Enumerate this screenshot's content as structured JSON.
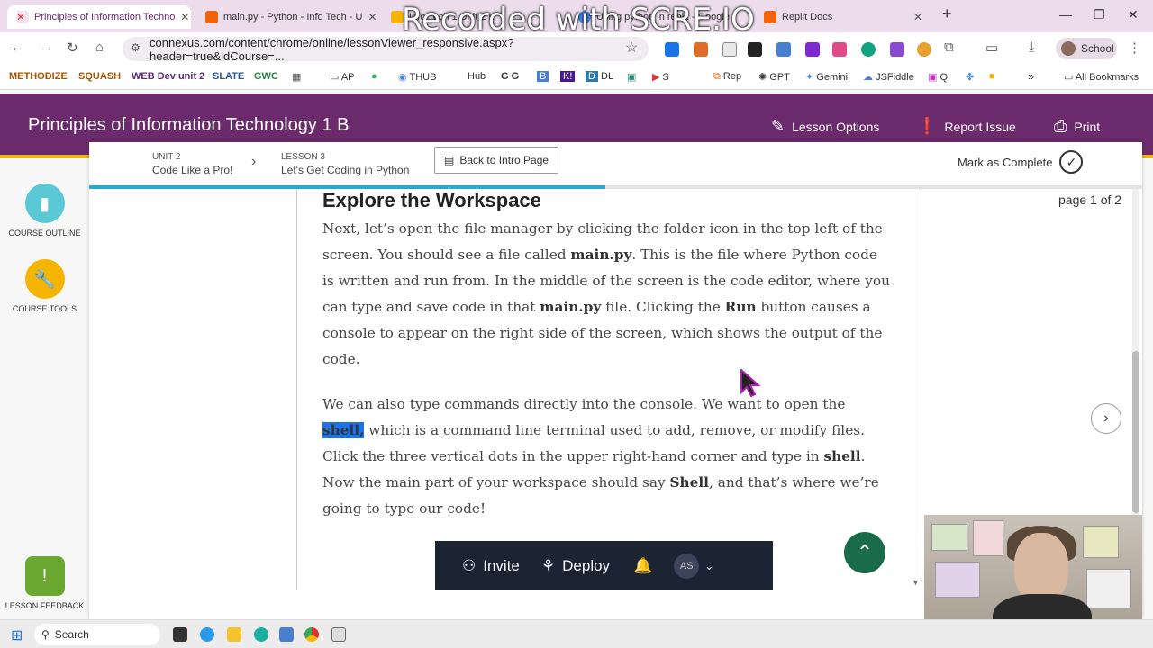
{
  "browser": {
    "tabs": [
      {
        "title": "Principles of Information Techno",
        "color": "#e03131"
      },
      {
        "title": "main.py - Python - Info Tech - U",
        "color": "#f26207"
      },
      {
        "title": "Info Tech 1 Unit 2 L",
        "color": "#f4b400"
      },
      {
        "title": "Using python in replit - Google",
        "color": "#4285f4"
      },
      {
        "title": "Replit Docs",
        "color": "#f26207"
      }
    ],
    "watermark": "Recorded with SCRE.IO",
    "url": "connexus.com/content/chrome/online/lessonViewer_responsive.aspx?header=true&idCourse=...",
    "profile": "School",
    "bookmarks": [
      "METHODIZE",
      "SQUASH",
      "WEB Dev unit 2",
      "SLATE",
      "GWC",
      "AP",
      "THUB",
      "Hub",
      "G",
      "DL",
      "S",
      "Rep",
      "GPT",
      "Gemini",
      "JSFiddle",
      "Q"
    ],
    "all_bookmarks": "All Bookmarks"
  },
  "header": {
    "course_title": "Principles of Information Technology 1 B",
    "lesson_options": "Lesson Options",
    "report_issue": "Report Issue",
    "print": "Print"
  },
  "sidebar": {
    "outline": "COURSE OUTLINE",
    "tools": "COURSE TOOLS",
    "feedback": "LESSON FEEDBACK"
  },
  "nav": {
    "unit_label": "UNIT 2",
    "unit_title": "Code Like a Pro!",
    "lesson_label": "LESSON 3",
    "lesson_title": "Let's Get Coding in Python",
    "back": "Back to Intro Page",
    "mark_complete": "Mark as Complete",
    "progress_percent": 49,
    "page_indicator": "page 1 of 2"
  },
  "lesson": {
    "heading": "Explore the Workspace",
    "p1_a": "Next, let’s open the file manager by clicking the folder icon in the top left of the screen. You should see a file called ",
    "p1_b": "main.py",
    "p1_c": ". This is the file where Python code is written and run from. In the middle of the screen is the code editor, where you can type and save code in that ",
    "p1_d": "main.py",
    "p1_e": " file. Clicking the ",
    "p1_f": "Run",
    "p1_g": " button causes a console to appear on the right side of the screen, which shows the output of the code.",
    "p2_a": "We can also type commands directly into the console. We want to open the ",
    "p2_b": "shell,",
    "p2_c": " which is a command line terminal used to add, remove, or modify files. Click the three vertical dots in the upper right-hand corner and type in ",
    "p2_d": "shell",
    "p2_e": ". Now the main part of your workspace should say ",
    "p2_f": "Shell",
    "p2_g": ", and that’s where we’re going to type our code!"
  },
  "replit_bar": {
    "invite": "Invite",
    "deploy": "Deploy",
    "avatar": "AS"
  },
  "taskbar": {
    "search": "Search"
  }
}
